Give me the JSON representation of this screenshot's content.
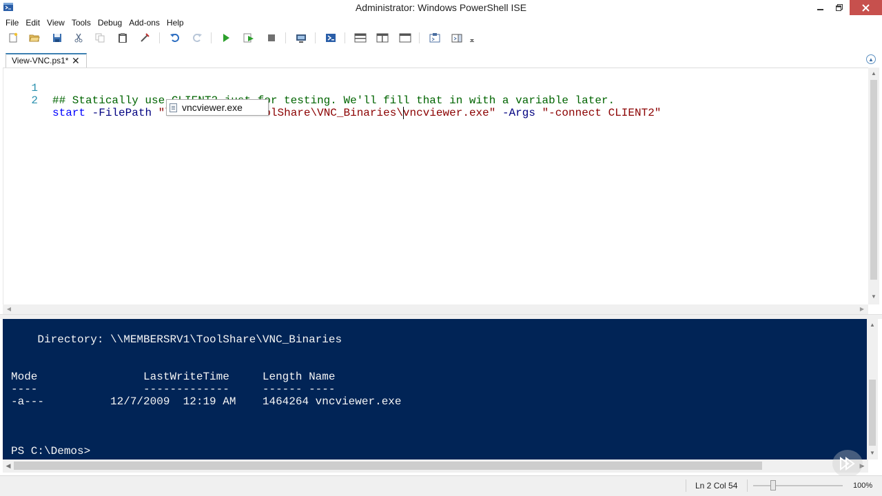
{
  "window": {
    "title": "Administrator: Windows PowerShell ISE",
    "close_color": "#c7504d"
  },
  "menubar": {
    "items": [
      "File",
      "Edit",
      "View",
      "Tools",
      "Debug",
      "Add-ons",
      "Help"
    ]
  },
  "toolbar": {
    "icons": [
      "new-file-icon",
      "open-folder-icon",
      "save-icon",
      "cut-icon",
      "copy-icon",
      "paste-icon",
      "clear-pane-icon",
      "undo-icon",
      "redo-icon",
      "run-script-icon",
      "run-selection-icon",
      "stop-icon",
      "new-remote-tab-icon",
      "start-powershell-icon",
      "show-script-pane-top-icon",
      "show-script-pane-right-icon",
      "show-script-pane-maximized-icon",
      "show-command-window-icon",
      "show-command-addon-icon",
      "toolbar-overflow-icon"
    ]
  },
  "tabs": [
    {
      "label": "View-VNC.ps1*",
      "active": true
    }
  ],
  "editor": {
    "lines": [
      {
        "num": "1",
        "comment": "## Statically use CLIENT2 just for testing. We'll fill that in with a variable later."
      },
      {
        "num": "2",
        "cmd": "start",
        "param1": "-FilePath",
        "str1_a": "\"\\\\MEMBERSRV1\\ToolShare\\VNC_Binaries\\",
        "str1_b": "vncviewer.exe\"",
        "param2": "-Args",
        "str2": "\"-connect CLIENT2\""
      }
    ],
    "intellisense": {
      "item": "vncviewer.exe"
    }
  },
  "console": {
    "lines": [
      "    Directory: \\\\MEMBERSRV1\\ToolShare\\VNC_Binaries",
      "Mode                LastWriteTime     Length Name",
      "----                -------------     ------ ----",
      "-a---          12/7/2009  12:19 AM    1464264 vncviewer.exe",
      "PS C:\\Demos>"
    ],
    "background": "#012456"
  },
  "status": {
    "position": "Ln 2  Col 54",
    "zoom_percent": 100,
    "zoom_label": "100%"
  }
}
